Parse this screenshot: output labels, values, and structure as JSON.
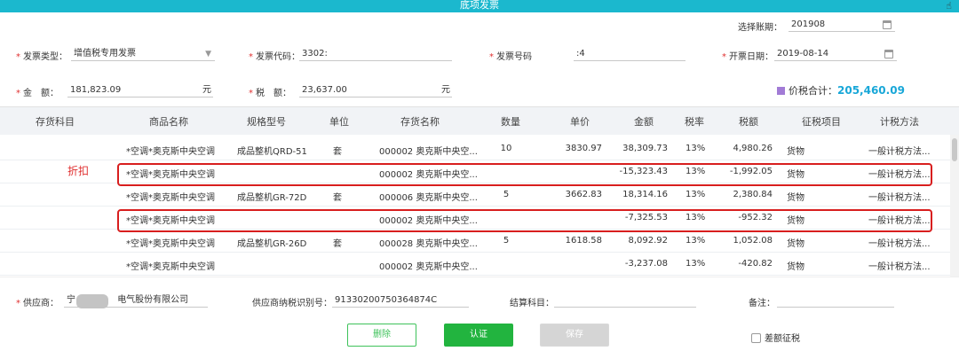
{
  "window": {
    "title": "底项发票"
  },
  "form": {
    "period_label": "选择账期：",
    "period_value": "201908",
    "invoice_type_label": "发票类型：",
    "invoice_type_value": "增值税专用发票",
    "invoice_code_label": "发票代码：",
    "invoice_code_value": "3302:",
    "invoice_no_label": "发票号码",
    "invoice_no_value": ":4",
    "issue_date_label": "开票日期：",
    "issue_date_value": "2019-08-14",
    "amount_label": "金　额：",
    "amount_value": "181,823.09",
    "amount_unit": "元",
    "tax_label": "税　额：",
    "tax_value": "23,637.00",
    "tax_unit": "元",
    "total_label": "价税合计：",
    "total_value": "205,460.09"
  },
  "table": {
    "headers": [
      "存货科目",
      "商品名称",
      "规格型号",
      "单位",
      "存货名称",
      "数量",
      "单价",
      "金额",
      "税率",
      "税额",
      "征税项目",
      "计税方法"
    ],
    "rows": [
      {
        "name": "*空调*奥克斯中央空调",
        "spec": "成品整机QRD-51",
        "unit": "套",
        "inventory": "000002 奥克斯中央空...",
        "qty": "10",
        "price": "3830.97",
        "amount": "38,309.73",
        "rate": "13%",
        "tax": "4,980.26",
        "item": "货物",
        "method": "一般计税方法..."
      },
      {
        "name": "*空调*奥克斯中央空调",
        "spec": "",
        "unit": "",
        "inventory": "000002 奥克斯中央空...",
        "qty": "",
        "price": "",
        "amount": "-15,323.43",
        "rate": "13%",
        "tax": "-1,992.05",
        "item": "货物",
        "method": "一般计税方法..."
      },
      {
        "name": "*空调*奥克斯中央空调",
        "spec": "成品整机GR-72D",
        "unit": "套",
        "inventory": "000006 奥克斯中央空...",
        "qty": "5",
        "price": "3662.83",
        "amount": "18,314.16",
        "rate": "13%",
        "tax": "2,380.84",
        "item": "货物",
        "method": "一般计税方法..."
      },
      {
        "name": "*空调*奥克斯中央空调",
        "spec": "",
        "unit": "",
        "inventory": "000002 奥克斯中央空...",
        "qty": "",
        "price": "",
        "amount": "-7,325.53",
        "rate": "13%",
        "tax": "-952.32",
        "item": "货物",
        "method": "一般计税方法..."
      },
      {
        "name": "*空调*奥克斯中央空调",
        "spec": "成品整机GR-26D",
        "unit": "套",
        "inventory": "000028 奥克斯中央空...",
        "qty": "5",
        "price": "1618.58",
        "amount": "8,092.92",
        "rate": "13%",
        "tax": "1,052.08",
        "item": "货物",
        "method": "一般计税方法..."
      },
      {
        "name": "*空调*奥克斯中央空调",
        "spec": "",
        "unit": "",
        "inventory": "000002 奥克斯中央空...",
        "qty": "",
        "price": "",
        "amount": "-3,237.08",
        "rate": "13%",
        "tax": "-420.82",
        "item": "货物",
        "method": "一般计税方法..."
      }
    ],
    "annotation": "折扣"
  },
  "footer": {
    "supplier_label": "供应商：",
    "supplier_value_prefix": "宁",
    "supplier_value_suffix": "电气股份有限公司",
    "tax_id_label": "供应商纳税识别号：",
    "tax_id_value": "91330200750364874C",
    "settle_label": "结算科目：",
    "remark_label": "备注：",
    "delete_label": "删除",
    "auth_label": "认证",
    "save_label": "保存",
    "diff_tax_label": "差额征税"
  },
  "colors": {
    "titlebar": "#1bb8ce",
    "highlight": "#d81e1e",
    "total": "#18a7d8",
    "primary_button": "#22b43f"
  }
}
